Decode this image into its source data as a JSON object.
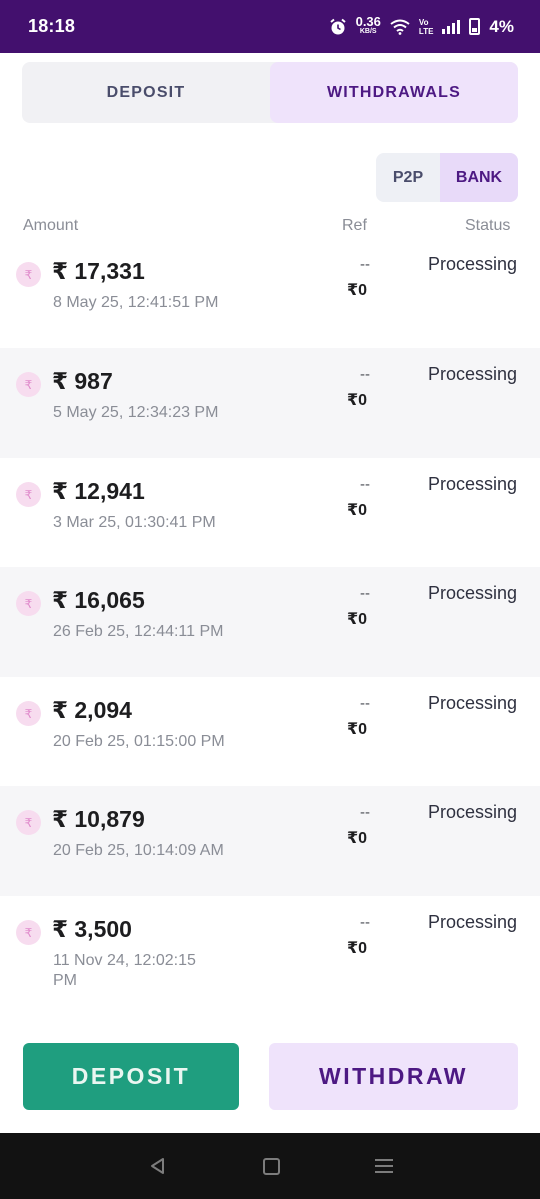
{
  "status_bar": {
    "time": "18:18",
    "speed_value": "0.36",
    "speed_unit": "KB/S",
    "volte_top": "Vo",
    "volte_bottom": "LTE",
    "battery": "4%"
  },
  "tabs": [
    {
      "label": "DEPOSIT",
      "active": false
    },
    {
      "label": "WITHDRAWALS",
      "active": true
    }
  ],
  "segment": [
    {
      "label": "P2P",
      "active": false
    },
    {
      "label": "BANK",
      "active": true
    }
  ],
  "columns": {
    "amount": "Amount",
    "ref": "Ref",
    "status": "Status"
  },
  "currency_symbol": "₹",
  "transactions": [
    {
      "amount": "₹ 17,331",
      "date": "8 May 25, 12:41:51 PM",
      "ref_dash": "--",
      "ref_value": "₹0",
      "status": "Processing"
    },
    {
      "amount": "₹ 987",
      "date": "5 May 25, 12:34:23 PM",
      "ref_dash": "--",
      "ref_value": "₹0",
      "status": "Processing"
    },
    {
      "amount": "₹ 12,941",
      "date": "3 Mar 25, 01:30:41 PM",
      "ref_dash": "--",
      "ref_value": "₹0",
      "status": "Processing"
    },
    {
      "amount": "₹ 16,065",
      "date": "26 Feb 25, 12:44:11 PM",
      "ref_dash": "--",
      "ref_value": "₹0",
      "status": "Processing"
    },
    {
      "amount": "₹ 2,094",
      "date": "20 Feb 25, 01:15:00 PM",
      "ref_dash": "--",
      "ref_value": "₹0",
      "status": "Processing"
    },
    {
      "amount": "₹ 10,879",
      "date": "20 Feb 25, 10:14:09 AM",
      "ref_dash": "--",
      "ref_value": "₹0",
      "status": "Processing"
    },
    {
      "amount": "₹ 3,500",
      "date": "11 Nov 24, 12:02:15 PM",
      "ref_dash": "--",
      "ref_value": "₹0",
      "status": "Processing"
    }
  ],
  "buttons": {
    "deposit": "DEPOSIT",
    "withdraw": "WITHDRAW"
  },
  "icons": {
    "alarm": "alarm-icon",
    "wifi": "wifi-icon",
    "signal": "signal-icon",
    "battery": "battery-icon",
    "coin": "rupee-coin-icon",
    "back": "back-icon",
    "home": "home-icon",
    "recents": "recents-icon"
  },
  "colors": {
    "status_bar": "#43106e",
    "accent_purple": "#4d1983",
    "tab_active_bg": "#efe3fb",
    "deposit_green": "#1f9e7f"
  }
}
